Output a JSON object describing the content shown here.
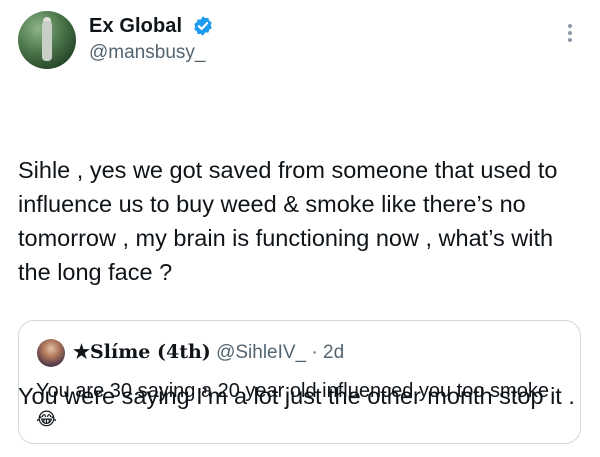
{
  "author": {
    "display_name": "Ex Global",
    "handle": "@mansbusy_",
    "verified_icon": "verified-badge-icon",
    "accent_color": "#1d9bf0"
  },
  "tweet": {
    "paragraph_1": "Sihle , yes we got saved from someone that used to influence us to buy weed & smoke like there’s no tomorrow , my brain is functioning now , what’s with the long face ?",
    "paragraph_2": "You were saying I’m a lot just the other month stop it ."
  },
  "quote": {
    "display_name": "★Slíme (4th)",
    "handle": "@SihleIV_",
    "separator": "·",
    "time": "2d",
    "text": "You are 30 saying a 20 year old influenced you too smoke",
    "emoji": "😂"
  },
  "icons": {
    "more": "more-options-icon"
  }
}
